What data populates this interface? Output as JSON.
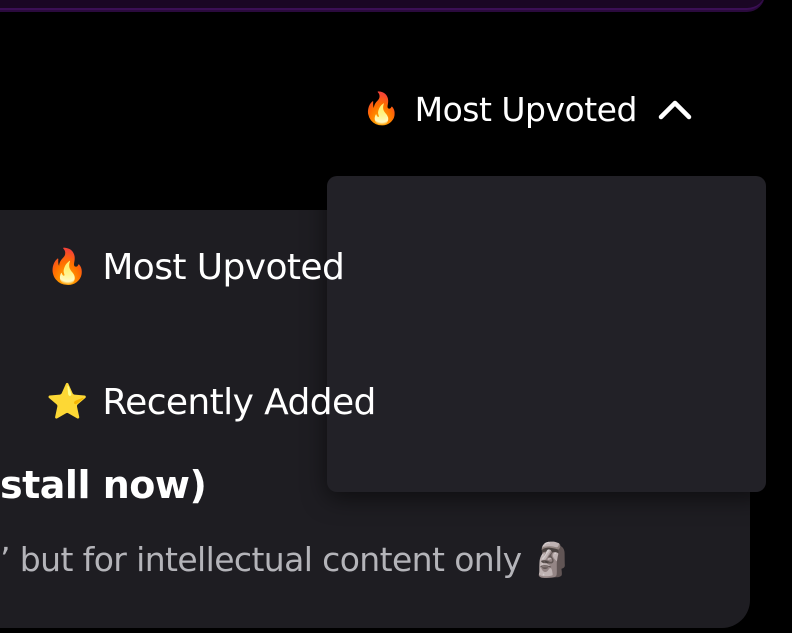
{
  "sort": {
    "current_emoji": "🔥",
    "current_label": "Most Upvoted",
    "chevron_icon": "chevron-up-icon",
    "expanded": true
  },
  "menu": {
    "items": [
      {
        "emoji": "🔥",
        "label": "Most Upvoted",
        "icon": "fire-icon"
      },
      {
        "emoji": "⭐",
        "label": "Recently Added",
        "icon": "star-icon"
      }
    ]
  },
  "card": {
    "title": "stall now)",
    "description": "’ but for intellectual content only 🗿"
  },
  "colors": {
    "background": "#000000",
    "card": "#1e1d22",
    "menu": "#222127",
    "banner": "#3b0f55",
    "muted_text": "#b4b4b9"
  }
}
